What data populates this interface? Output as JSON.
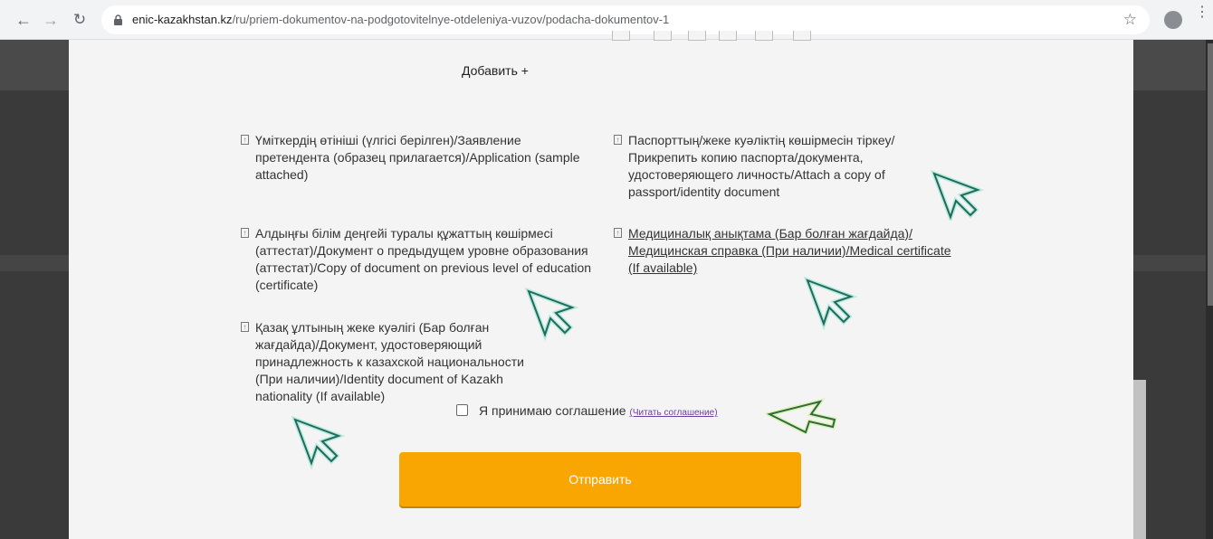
{
  "browser": {
    "url_host": "enic-kazakhstan.kz",
    "url_path": "/ru/priem-dokumentov-na-podgotovitelnye-otdeleniya-vuzov/podacha-dokumentov-1",
    "icons": [
      "back-icon",
      "forward-icon",
      "reload-icon",
      "lock-icon",
      "star-icon",
      "profile-icon",
      "menu-icon"
    ]
  },
  "form": {
    "add_label": "Добавить +",
    "documents": [
      {
        "label": "Үміткердің өтініші (үлгісі берілген)/Заявление претендента (образец прилагается)/Application (sample attached)",
        "is_link": false
      },
      {
        "label": "Паспорттың/жеке куәліктің көшірмесін тіркеу/ Прикрепить копию паспорта/документа, удостоверяющего личность/Attach a copy of passport/identity document",
        "is_link": false
      },
      {
        "label": "Алдыңғы білім деңгейі туралы құжаттың көшірмесі (аттестат)/Документ о предыдущем уровне образования (аттестат)/Copy of document on previous level of education (certificate)",
        "is_link": false
      },
      {
        "label": "Медициналық анықтама (Бар болған жағдайда)/ Медицинская справка (При наличии)/Medical certificate (If available)",
        "is_link": true
      },
      {
        "label": "Қазақ ұлтының жеке куәлігі (Бар болған жағдайда)/Документ, удостоверяющий принадлежность к казахской национальности (При наличии)/Identity document of Kazakh nationality (If available)",
        "is_link": false
      }
    ],
    "agreement_label": "Я принимаю соглашение",
    "agreement_link": "(Читать соглашение)",
    "agreement_checked": false,
    "submit_label": "Отправить"
  },
  "colors": {
    "submit": "#f9a602",
    "panel": "#f4f4f4",
    "background": "#3a3a3a",
    "link": "#6a3fa0"
  }
}
